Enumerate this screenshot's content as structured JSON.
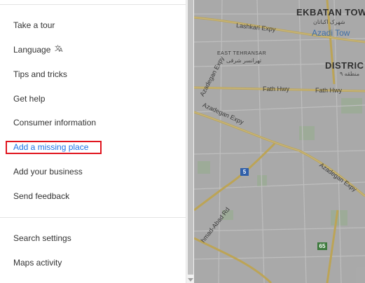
{
  "menu": {
    "take_tour": "Take a tour",
    "language": "Language",
    "language_icon": "translate-icon",
    "tips": "Tips and tricks",
    "help": "Get help",
    "consumer": "Consumer information",
    "add_missing": "Add a missing place",
    "add_business": "Add your business",
    "feedback": "Send feedback",
    "search_settings": "Search settings",
    "maps_activity": "Maps activity"
  },
  "map": {
    "labels": {
      "ekbatan": "EKBATAN TOW",
      "ekbatan_fa": "شهرک اکباتان",
      "azadi": "Azadi Tow",
      "lashkari": "Lashkari Expy",
      "east_tehransar": "EAST TEHRANSAR",
      "east_tehransar_fa": "تهرانسر شرقی",
      "district": "DISTRIC",
      "district_fa": "منطقه ۹",
      "azadegan_upper": "Azadegan Expy",
      "fath1": "Fath Hwy",
      "fath2": "Fath Hwy",
      "azadegan": "Azadegan Expy",
      "azadegan_right": "Azadegan Expy",
      "ahmad": "hmad-Abad Rd"
    },
    "shields": {
      "route5": "5",
      "route65": "65"
    }
  },
  "colors": {
    "highlight": "#e0161f",
    "link": "#1a73e8"
  }
}
